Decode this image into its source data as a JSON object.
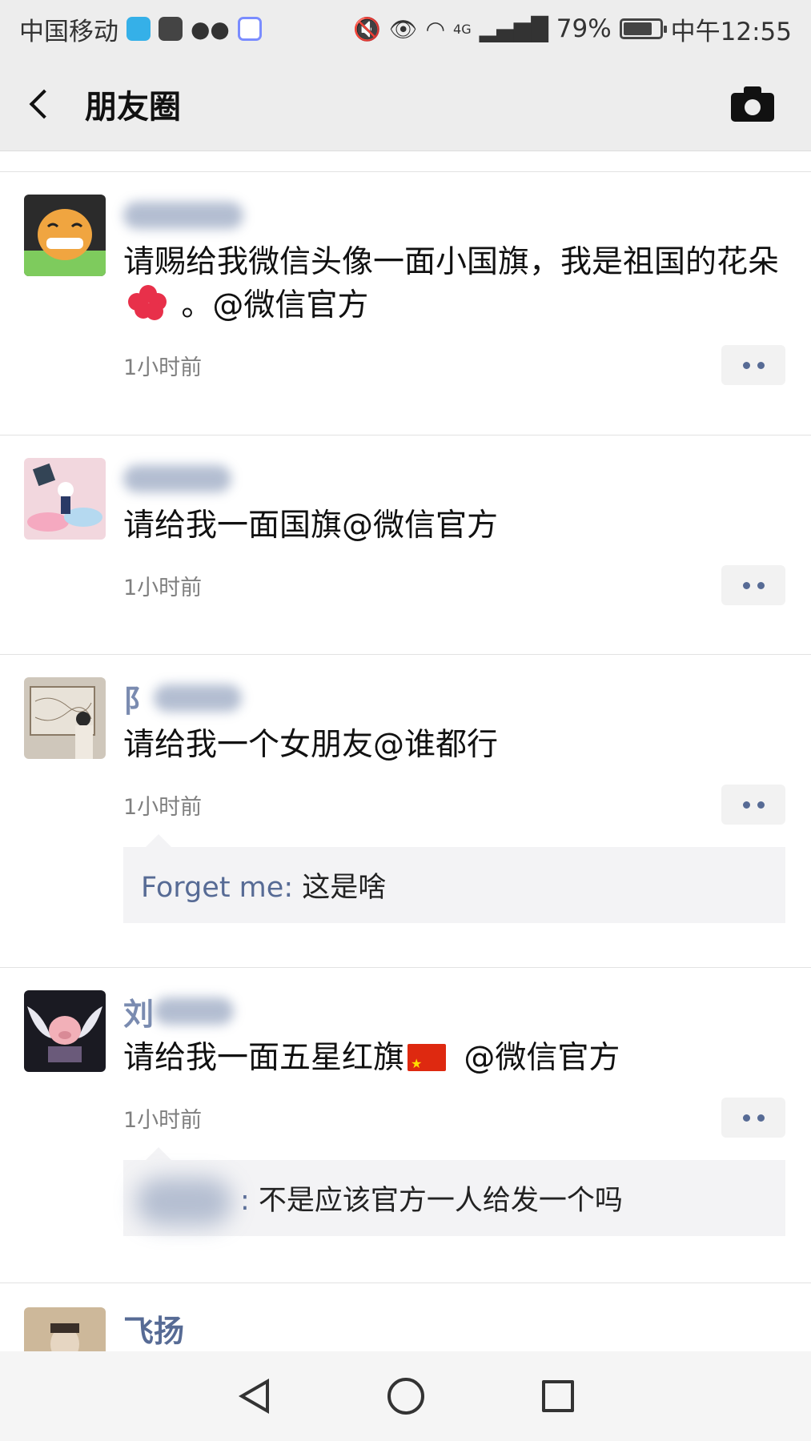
{
  "status_bar": {
    "carrier": "中国移动",
    "network": "4G",
    "battery": "79%",
    "battery_level": 0.79,
    "time": "中午12:55",
    "app_icon_colors": [
      "#35b0e8",
      "#444444",
      "#444444",
      "#7a8cff"
    ]
  },
  "nav": {
    "title": "朋友圈",
    "back_icon": "chevron-left-icon",
    "camera_icon": "camera-icon"
  },
  "posts": [
    {
      "nickname": "",
      "content_before": "请赐给我微信头像一面小国旗，我是祖国的花朵",
      "content_after": " 。@微信官方",
      "time": "1小时前",
      "avatar_colors": [
        "#7ecb5d",
        "#f0a540",
        "#2b2b2b"
      ]
    },
    {
      "nickname": "",
      "content": "请给我一面国旗@微信官方",
      "time": "1小时前",
      "avatar_colors": [
        "#f2d7de",
        "#b5d9f0",
        "#334455"
      ]
    },
    {
      "nickname": "",
      "content": "请给我一个女朋友@谁都行",
      "time": "1小时前",
      "avatar_colors": [
        "#cfc7bb",
        "#8a7a66",
        "#2a2a2a"
      ],
      "comment": {
        "name": "Forget me",
        "separator": ": ",
        "text": "这是啥"
      }
    },
    {
      "nickname": "",
      "content_before": "请给我一面五星红旗",
      "content_after": " @微信官方",
      "time": "1小时前",
      "avatar_colors": [
        "#1a1a22",
        "#e8e8f0",
        "#f2b0b8"
      ],
      "comment": {
        "name": "",
        "separator": ": ",
        "text": "不是应该官方一人给发一个吗"
      }
    },
    {
      "nickname": "飞扬",
      "avatar_colors": [
        "#cdb89a",
        "#3a2f28",
        "#e6d6c2"
      ]
    }
  ],
  "colors": {
    "link_blue": "#576b95",
    "bar_bg": "#ededed"
  }
}
